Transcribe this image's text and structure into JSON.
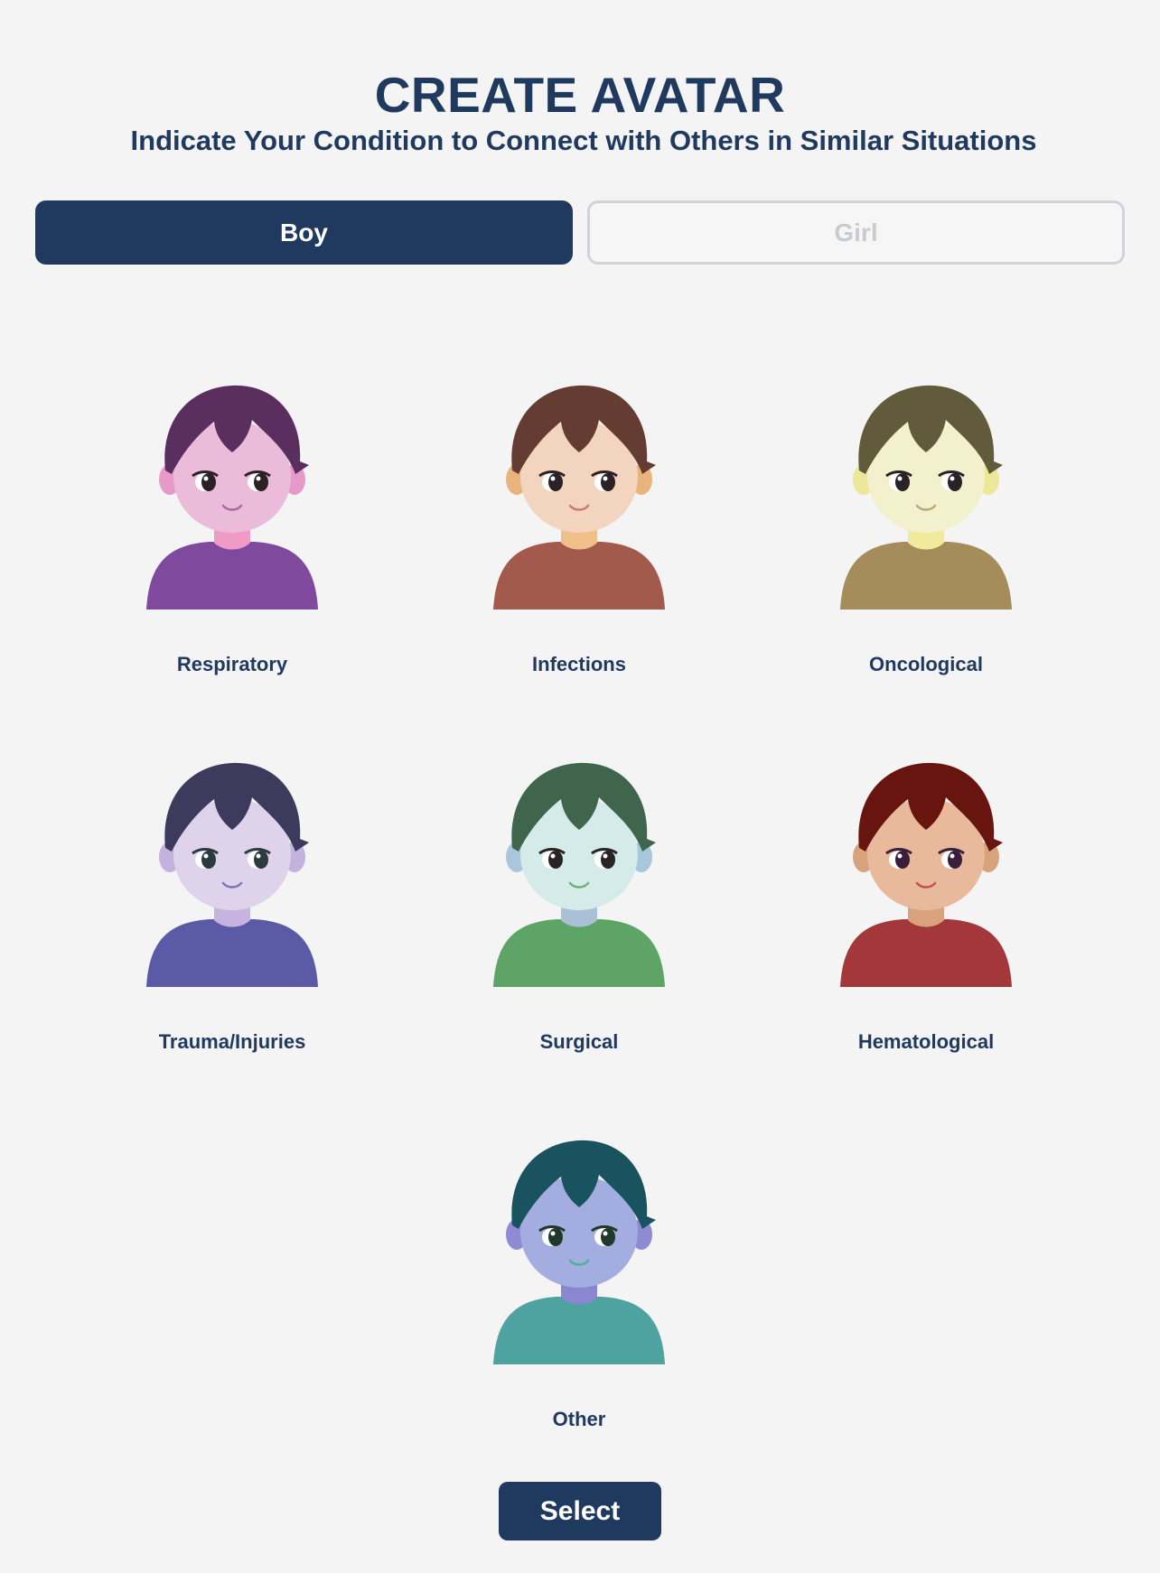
{
  "header": {
    "title": "CREATE AVATAR",
    "subtitle": "Indicate Your Condition to Connect with Others in Similar Situations"
  },
  "tabs": {
    "boy": "Boy",
    "girl": "Girl",
    "selected": "Boy"
  },
  "avatars": [
    {
      "label": "Respiratory",
      "hair": "#5b2e60",
      "skin": "#ebbcd9",
      "ear": "#e79ac9",
      "neck": "#f09ac6",
      "shirt": "#7f4a9e",
      "mouth": "#a86aa0",
      "eye": "#2b2226"
    },
    {
      "label": "Infections",
      "hair": "#643c32",
      "skin": "#f3d5bf",
      "ear": "#e9b47c",
      "neck": "#f0bf8a",
      "shirt": "#a35a4d",
      "mouth": "#c97a6a",
      "eye": "#2b2226"
    },
    {
      "label": "Oncological",
      "hair": "#615a3b",
      "skin": "#f3f1cd",
      "ear": "#ece799",
      "neck": "#f1ea9c",
      "shirt": "#a68b5b",
      "mouth": "#b8a87a",
      "eye": "#2b2226"
    },
    {
      "label": "Trauma/Injuries",
      "hair": "#3c3b5e",
      "skin": "#ded3ea",
      "ear": "#c4b2de",
      "neck": "#c7b3e0",
      "shirt": "#5b5aa6",
      "mouth": "#7f73b8",
      "eye": "#2b3a3e"
    },
    {
      "label": "Surgical",
      "hair": "#3f654d",
      "skin": "#d5ebe9",
      "ear": "#a8c7dd",
      "neck": "#a9c0d6",
      "shirt": "#5ea466",
      "mouth": "#6cb27a",
      "eye": "#2b2226"
    },
    {
      "label": "Hematological",
      "hair": "#681510",
      "skin": "#e8b99b",
      "ear": "#d6a37a",
      "neck": "#d9a27c",
      "shirt": "#a3373a",
      "mouth": "#c0505a",
      "eye": "#3a1f3a"
    },
    {
      "label": "Other",
      "hair": "#1a5360",
      "skin": "#a3addf",
      "ear": "#8e8ad3",
      "neck": "#8a86cf",
      "shirt": "#4ea3a1",
      "mouth": "#4cb39a",
      "eye": "#1f3a2a"
    }
  ],
  "actions": {
    "select": "Select"
  }
}
